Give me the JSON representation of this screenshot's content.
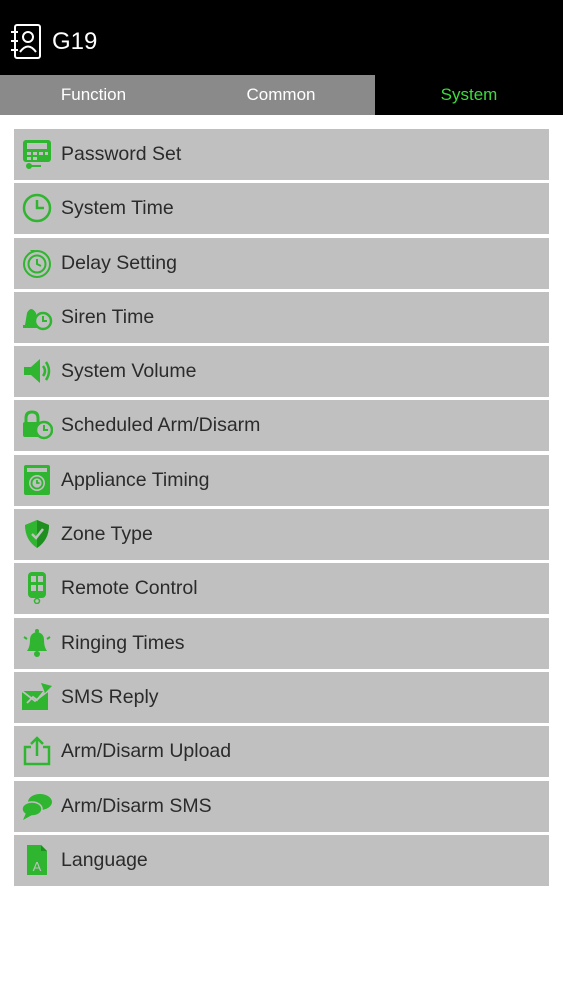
{
  "header": {
    "title": "G19",
    "icon": "address-book-icon"
  },
  "tabs": [
    {
      "label": "Function",
      "active": false
    },
    {
      "label": "Common",
      "active": false
    },
    {
      "label": "System",
      "active": true
    }
  ],
  "menu": [
    {
      "label": "Password Set",
      "icon": "keypad-icon"
    },
    {
      "label": "System Time",
      "icon": "clock-icon"
    },
    {
      "label": "Delay Setting",
      "icon": "timer-icon"
    },
    {
      "label": "Siren Time",
      "icon": "siren-clock-icon"
    },
    {
      "label": "System Volume",
      "icon": "speaker-icon"
    },
    {
      "label": "Scheduled Arm/Disarm",
      "icon": "lock-clock-icon"
    },
    {
      "label": "Appliance Timing",
      "icon": "appliance-icon"
    },
    {
      "label": "Zone Type",
      "icon": "shield-icon"
    },
    {
      "label": "Remote Control",
      "icon": "remote-icon"
    },
    {
      "label": "Ringing Times",
      "icon": "bell-icon"
    },
    {
      "label": "SMS Reply",
      "icon": "sms-reply-icon"
    },
    {
      "label": "Arm/Disarm Upload",
      "icon": "upload-icon"
    },
    {
      "label": "Arm/Disarm SMS",
      "icon": "chat-bubbles-icon"
    },
    {
      "label": "Language",
      "icon": "language-icon"
    }
  ],
  "colors": {
    "accent": "#3ddc3d",
    "icon_green": "#2fb52f",
    "header_bg": "#000000",
    "tab_bg": "#8a8a8a",
    "row_bg": "#c0c0c0"
  }
}
